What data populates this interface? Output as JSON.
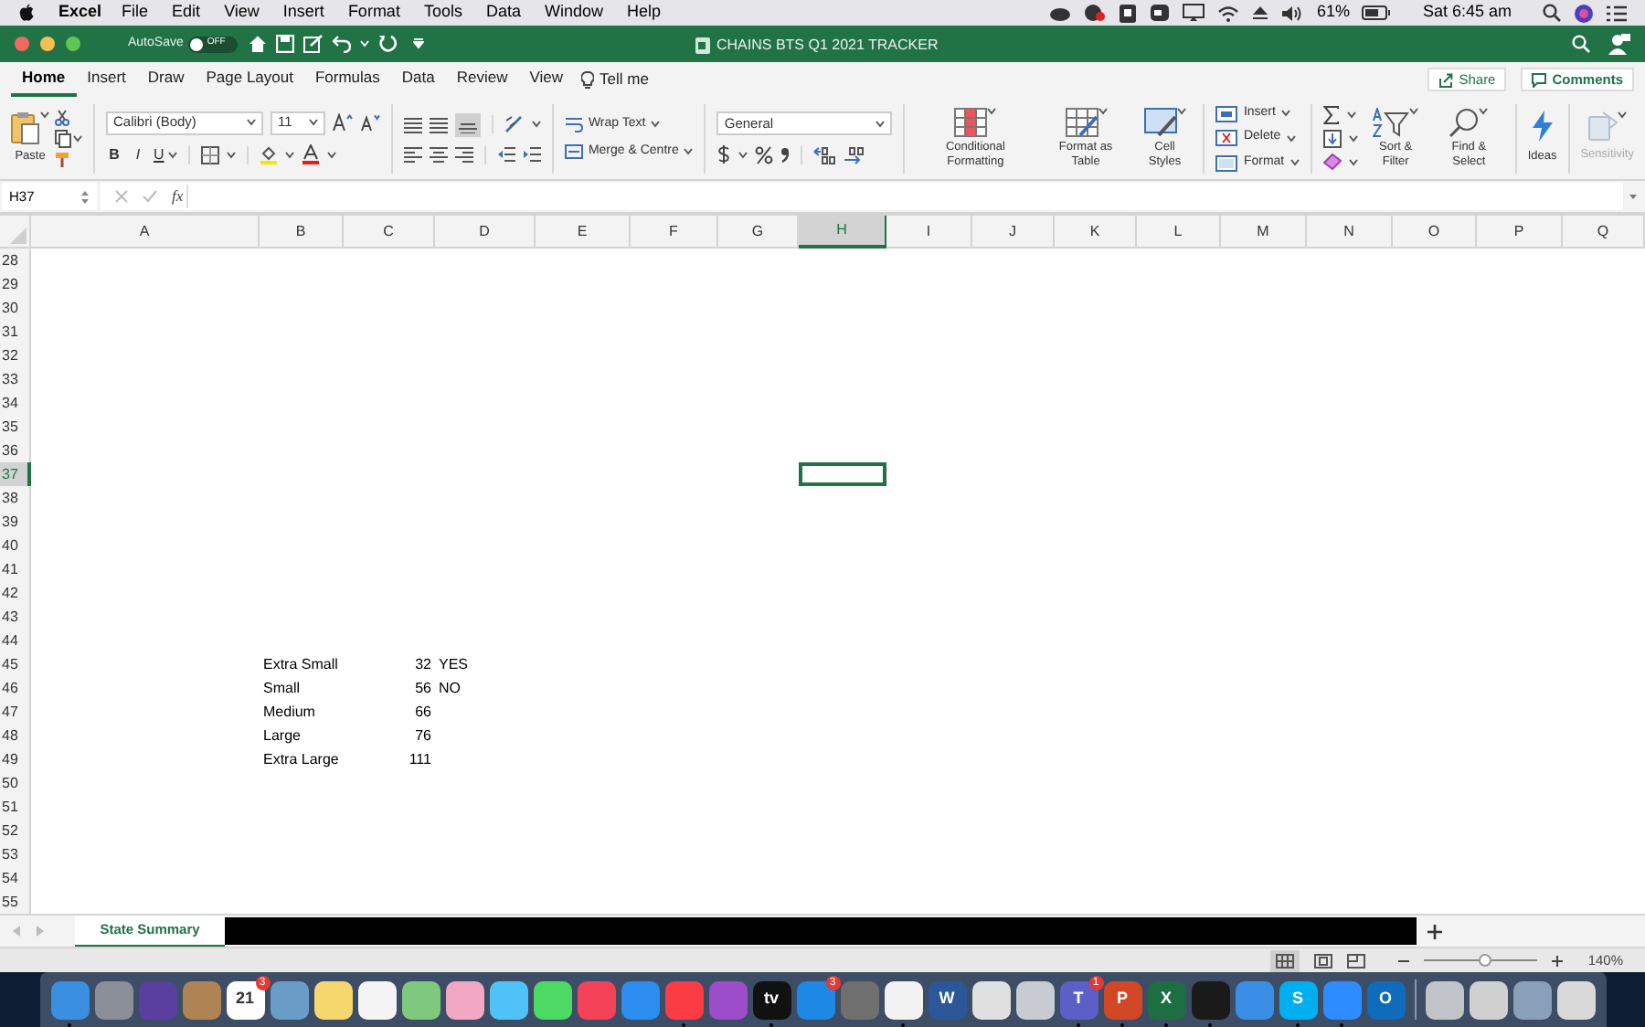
{
  "menu_bar": {
    "app": "Excel",
    "items": [
      "File",
      "Edit",
      "View",
      "Insert",
      "Format",
      "Tools",
      "Data",
      "Window",
      "Help"
    ],
    "battery": "61%",
    "clock": "Sat 6:45 am"
  },
  "title_bar": {
    "autosave_label": "AutoSave",
    "autosave_on": false,
    "autosave_state": "OFF",
    "title": "CHAINS BTS Q1 2021 TRACKER"
  },
  "ribbon_tabs": [
    {
      "label": "Home",
      "selected": true
    },
    {
      "label": "Insert",
      "selected": false
    },
    {
      "label": "Draw",
      "selected": false
    },
    {
      "label": "Page Layout",
      "selected": false
    },
    {
      "label": "Formulas",
      "selected": false
    },
    {
      "label": "Data",
      "selected": false
    },
    {
      "label": "Review",
      "selected": false
    },
    {
      "label": "View",
      "selected": false
    }
  ],
  "tell_me": "Tell me",
  "share": "Share",
  "comments": "Comments",
  "ribbon": {
    "paste": "Paste",
    "font": "Calibri (Body)",
    "size": "11",
    "bold": "B",
    "italic": "I",
    "underline": "U",
    "wrap_text": "Wrap Text",
    "merge": "Merge & Centre",
    "number_format": "General",
    "conditional_formatting": "Conditional Formatting",
    "format_as_table": "Format as Table",
    "cell_styles": "Cell Styles",
    "insert": "Insert",
    "delete": "Delete",
    "format": "Format",
    "sort_filter": "Sort & Filter",
    "find_select": "Find & Select",
    "ideas": "Ideas",
    "sensitivity": "Sensitivity"
  },
  "formula_bar": {
    "name_box": "H37",
    "fx": "fx"
  },
  "columns": [
    {
      "label": "A",
      "selected": false
    },
    {
      "label": "B",
      "selected": false
    },
    {
      "label": "C",
      "selected": false
    },
    {
      "label": "D",
      "selected": false
    },
    {
      "label": "E",
      "selected": false
    },
    {
      "label": "F",
      "selected": false
    },
    {
      "label": "G",
      "selected": false
    },
    {
      "label": "H",
      "selected": true
    },
    {
      "label": "I",
      "selected": false
    },
    {
      "label": "J",
      "selected": false
    },
    {
      "label": "K",
      "selected": false
    },
    {
      "label": "L",
      "selected": false
    },
    {
      "label": "M",
      "selected": false
    },
    {
      "label": "N",
      "selected": false
    },
    {
      "label": "O",
      "selected": false
    },
    {
      "label": "P",
      "selected": false
    },
    {
      "label": "Q",
      "selected": false
    }
  ],
  "rows": [
    {
      "number": "28",
      "selected": false
    },
    {
      "number": "29",
      "selected": false
    },
    {
      "number": "30",
      "selected": false
    },
    {
      "number": "31",
      "selected": false
    },
    {
      "number": "32",
      "selected": false
    },
    {
      "number": "33",
      "selected": false
    },
    {
      "number": "34",
      "selected": false
    },
    {
      "number": "35",
      "selected": false
    },
    {
      "number": "36",
      "selected": false
    },
    {
      "number": "37",
      "selected": true
    },
    {
      "number": "38",
      "selected": false
    },
    {
      "number": "39",
      "selected": false
    },
    {
      "number": "40",
      "selected": false
    },
    {
      "number": "41",
      "selected": false
    },
    {
      "number": "42",
      "selected": false
    },
    {
      "number": "43",
      "selected": false
    },
    {
      "number": "44",
      "selected": false
    },
    {
      "number": "45",
      "selected": false,
      "cells": {
        "B": "Extra Small",
        "C": "32",
        "D": "YES"
      }
    },
    {
      "number": "46",
      "selected": false,
      "cells": {
        "B": "Small",
        "C": "56",
        "D": "NO"
      }
    },
    {
      "number": "47",
      "selected": false,
      "cells": {
        "B": "Medium",
        "C": "66"
      }
    },
    {
      "number": "48",
      "selected": false,
      "cells": {
        "B": "Large",
        "C": "76"
      }
    },
    {
      "number": "49",
      "selected": false,
      "cells": {
        "B": "Extra Large",
        "C": "111"
      }
    },
    {
      "number": "50",
      "selected": false
    },
    {
      "number": "51",
      "selected": false
    },
    {
      "number": "52",
      "selected": false
    },
    {
      "number": "53",
      "selected": false
    },
    {
      "number": "54",
      "selected": false
    },
    {
      "number": "55",
      "selected": false
    }
  ],
  "sheet_tabs": [
    {
      "label": "State Summary",
      "selected": true
    }
  ],
  "status_bar": {
    "zoom": "140%",
    "zoom_slider": {
      "level": 0.53
    }
  },
  "dock": {
    "apps": [
      {
        "color": "#3b8fe0",
        "running": true
      },
      {
        "color": "#8a8f99",
        "running": false
      },
      {
        "color": "#5a3fa0",
        "running": false
      },
      {
        "color": "#b08355",
        "running": false
      },
      {
        "color": "#ffffff",
        "label": "21",
        "badge": "3",
        "running": false
      },
      {
        "color": "#6a9cc8",
        "running": false
      },
      {
        "color": "#f5d76e",
        "running": false
      },
      {
        "color": "#f4f4f4",
        "running": false
      },
      {
        "color": "#7fc97f",
        "running": false
      },
      {
        "color": "#f2a7c3",
        "running": false
      },
      {
        "color": "#4fc3f7",
        "running": false
      },
      {
        "color": "#4cd964",
        "running": false
      },
      {
        "color": "#f44359",
        "running": false
      },
      {
        "color": "#2d8cf0",
        "running": false
      },
      {
        "color": "#fc3c44",
        "running": true
      },
      {
        "color": "#9b4dca",
        "running": false
      },
      {
        "color": "#111111",
        "label": "tv",
        "running": true
      },
      {
        "color": "#1e88e5",
        "badge": "3",
        "running": false
      },
      {
        "color": "#6f6f6f",
        "running": false
      },
      {
        "color": "#f2f2f2",
        "running": true
      },
      {
        "color": "#2b579a",
        "label": "W",
        "running": false
      },
      {
        "color": "#e0e0e0",
        "running": false
      },
      {
        "color": "#c8ccd2",
        "running": false
      },
      {
        "color": "#5b5fc7",
        "label": "T",
        "badge": "1",
        "running": true
      },
      {
        "color": "#d24726",
        "label": "P",
        "running": true
      },
      {
        "color": "#1d6f42",
        "label": "X",
        "running": true
      },
      {
        "color": "#1a1a1a",
        "running": true
      },
      {
        "color": "#3a8ee6",
        "running": false
      },
      {
        "color": "#00aff0",
        "label": "S",
        "running": true
      },
      {
        "color": "#2d8cff",
        "running": true
      },
      {
        "color": "#0f6cbd",
        "label": "O",
        "running": false
      }
    ],
    "recent": [
      {
        "color": "#c0c4c8"
      },
      {
        "color": "#d0d0d0"
      },
      {
        "color": "#8aa0b8"
      },
      {
        "color": "#d9d9d9"
      }
    ]
  }
}
